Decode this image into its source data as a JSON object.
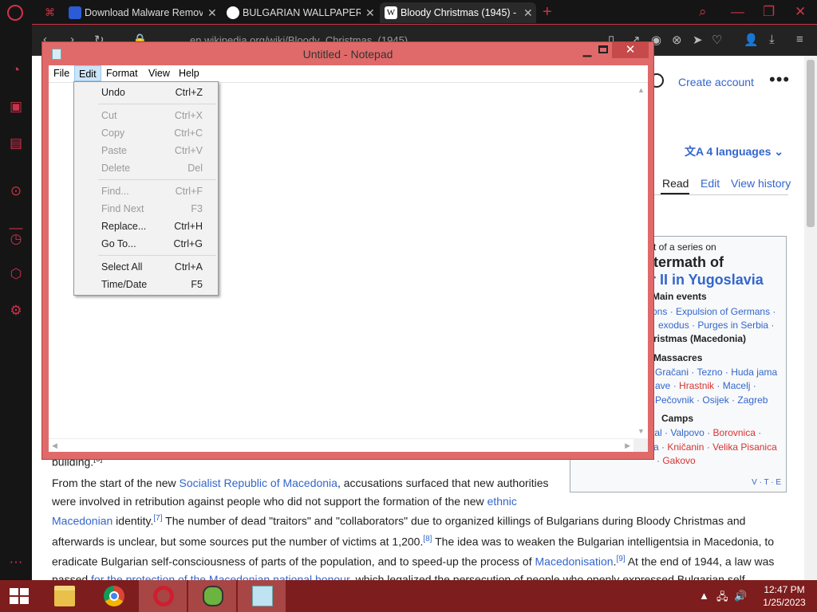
{
  "browser": {
    "tabs": [
      {
        "title": "Download Malware Remov",
        "favicon_color": "#2b5bd7"
      },
      {
        "title": "BULGARIAN WALLPAPERS -",
        "favicon_color": "#ffffff"
      },
      {
        "title": "Bloody Christmas (1945) - W",
        "favicon_color": "#ffffff",
        "active": true
      }
    ],
    "address": "en.wikipedia.org/wiki/Bloody_Christmas_(1945)",
    "accent_color": "#c93448"
  },
  "wiki": {
    "create_account": "Create account",
    "languages": "4 languages",
    "tabs": [
      "Read",
      "Edit",
      "View history"
    ],
    "infobox": {
      "series_label": "t of a series on",
      "heading_1": "termath of",
      "heading_2": "r II in Yugoslavia",
      "main_events_label": "Main events",
      "main_events_1": [
        "ons",
        "Expulsion of Germans"
      ],
      "main_events_2": [
        "exodus",
        "Purges in Serbia"
      ],
      "main_events_3": "ristmas (Macedonia)",
      "massacres_label": "Massacres",
      "massacres_1": [
        "Gračani",
        "Tezno",
        "Huda jama"
      ],
      "massacres_2": [
        "ave",
        "Hrastnik",
        "Macelj"
      ],
      "massacres_3": [
        "Pečovnik",
        "Osijek",
        "Zagreb"
      ],
      "camps_label": "Camps",
      "camps_1": [
        "tal",
        "Valpovo",
        "Borovnica"
      ],
      "camps_2": [
        "a",
        "Kničanin",
        "Velika Pisanica"
      ],
      "camps_3": [
        "Gakovo"
      ],
      "vte": "V · T · E"
    },
    "partial_line": {
      "text": "building.",
      "ref": "[6]"
    },
    "paragraph": {
      "l1_a": "From the start of the new ",
      "l1_link": "Socialist Republic of Macedonia",
      "l1_b": ", accusations surfaced that new authorities",
      "l2_a": "were involved in retribution against people who did not support the formation of the new ",
      "l2_link": "ethnic",
      "l3_link": "Macedonian",
      "l3_b": " identity.",
      "l3_ref": "[7]",
      "l3_c": " The number of dead \"traitors\" and \"collaborators\" due to organized killings of Bulgarians during Bloody Christmas and",
      "l4_a": "afterwards is unclear, but some sources put the number of victims at 1,200.",
      "l4_ref": "[8]",
      "l4_b": " The idea was to weaken the Bulgarian intelligentsia in Macedonia, to",
      "l5_a": "eradicate Bulgarian self-consciousness of parts of the population, and to speed-up the process of ",
      "l5_link": "Macedonisation",
      "l5_b": ".",
      "l5_ref": "[9]",
      "l5_c": " At the end of 1944, a law was",
      "l6_a": "passed ",
      "l6_link": "for the protection of the Macedonian national honour",
      "l6_b": ", which legalized the persecution of people who openly expressed Bulgarian self-"
    }
  },
  "notepad": {
    "title": "Untitled - Notepad",
    "menus": [
      "File",
      "Edit",
      "Format",
      "View",
      "Help"
    ],
    "selected_menu": "Edit",
    "edit_menu": [
      {
        "label": "Undo",
        "shortcut": "Ctrl+Z",
        "enabled": true
      },
      {
        "label": "Cut",
        "shortcut": "Ctrl+X",
        "enabled": false
      },
      {
        "label": "Copy",
        "shortcut": "Ctrl+C",
        "enabled": false
      },
      {
        "label": "Paste",
        "shortcut": "Ctrl+V",
        "enabled": false
      },
      {
        "label": "Delete",
        "shortcut": "Del",
        "enabled": false
      },
      {
        "label": "Find...",
        "shortcut": "Ctrl+F",
        "enabled": false
      },
      {
        "label": "Find Next",
        "shortcut": "F3",
        "enabled": false
      },
      {
        "label": "Replace...",
        "shortcut": "Ctrl+H",
        "enabled": true
      },
      {
        "label": "Go To...",
        "shortcut": "Ctrl+G",
        "enabled": true
      },
      {
        "label": "Select All",
        "shortcut": "Ctrl+A",
        "enabled": true
      },
      {
        "label": "Time/Date",
        "shortcut": "F5",
        "enabled": true
      }
    ]
  },
  "taskbar": {
    "time": "12:47 PM",
    "date": "1/25/2023",
    "color": "#7e1d1d"
  }
}
